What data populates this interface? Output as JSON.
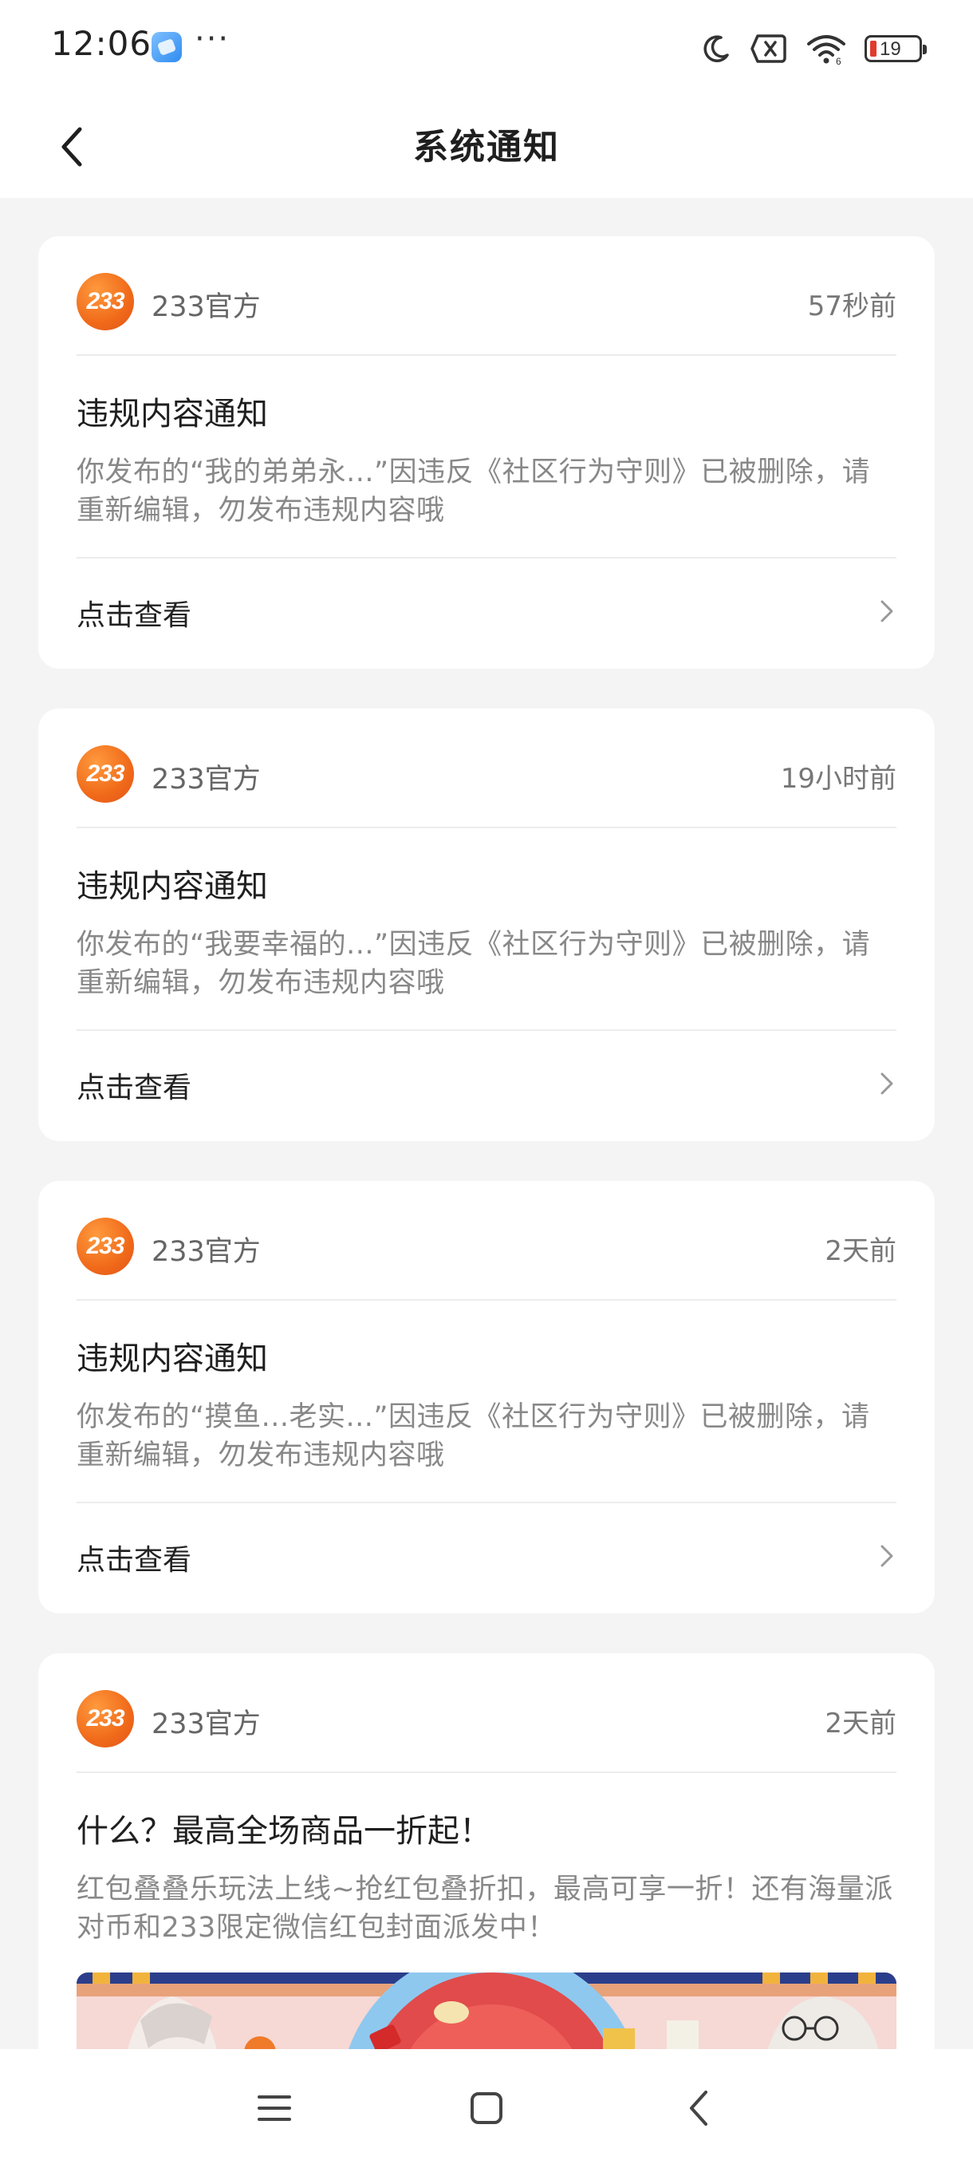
{
  "status_bar": {
    "time": "12:06",
    "more": "···",
    "battery_level": "19",
    "icons": [
      "moon-icon",
      "no-sim-icon",
      "wifi-icon",
      "battery-icon"
    ]
  },
  "header": {
    "title": "系统通知",
    "back_icon": "chevron-left-icon"
  },
  "notifications": [
    {
      "avatar_text": "233",
      "sender": "233官方",
      "time": "57秒前",
      "title": "违规内容通知",
      "body": "你发布的“我的弟弟永...”因违反《社区行为守则》已被删除，请重新编辑，勿发布违规内容哦",
      "link_label": "点击查看"
    },
    {
      "avatar_text": "233",
      "sender": "233官方",
      "time": "19小时前",
      "title": "违规内容通知",
      "body": "你发布的“我要幸福的...”因违反《社区行为守则》已被删除，请重新编辑，勿发布违规内容哦",
      "link_label": "点击查看"
    },
    {
      "avatar_text": "233",
      "sender": "233官方",
      "time": "2天前",
      "title": "违规内容通知",
      "body": "你发布的“摸鱼...老实...”因违反《社区行为守则》已被删除，请重新编辑，勿发布违规内容哦",
      "link_label": "点击查看"
    },
    {
      "avatar_text": "233",
      "sender": "233官方",
      "time": "2天前",
      "title": "什么？最高全场商品一折起！",
      "body": "红包叠叠乐玩法上线~抢红包叠折扣，最高可享一折！还有海量派对币和233限定微信红包封面派发中！"
    }
  ],
  "colors": {
    "accent_orange": "#f06a1a",
    "background": "#f4f4f4",
    "card": "#ffffff"
  },
  "nav_bar": {
    "icons": [
      "menu-icon",
      "home-square-icon",
      "back-icon"
    ]
  }
}
